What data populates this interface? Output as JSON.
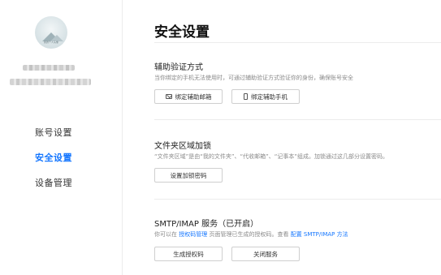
{
  "sidebar": {
    "avatar_caption": "我的个人头像",
    "nav": [
      {
        "label": "账号设置",
        "active": false
      },
      {
        "label": "安全设置",
        "active": true
      },
      {
        "label": "设备管理",
        "active": false
      }
    ]
  },
  "page": {
    "title": "安全设置"
  },
  "sections": {
    "auth": {
      "title": "辅助验证方式",
      "desc": "当你绑定的手机无法使用时，可通过辅助验证方式验证你的身份，确保账号安全",
      "bind_email_label": "绑定辅助邮箱",
      "bind_phone_label": "绑定辅助手机"
    },
    "folder": {
      "title": "文件夹区域加锁",
      "desc": "“文件夹区域”是由“我的文件夹”、“代收邮箱”、“记事本”组成。加锁通过这几部分设置密码。",
      "set_password_label": "设置加锁密码"
    },
    "smtp": {
      "title": "SMTP/IMAP 服务（已开启）",
      "desc_prefix": "你可以在",
      "desc_link1": "授权码管理",
      "desc_middle": "页面管理已生成的授权码。查看",
      "desc_link2": "配置 SMTP/IMAP 方法",
      "generate_label": "生成授权码",
      "close_label": "关闭服务"
    }
  },
  "colors": {
    "accent": "#1677ff",
    "divider": "#ececec"
  }
}
